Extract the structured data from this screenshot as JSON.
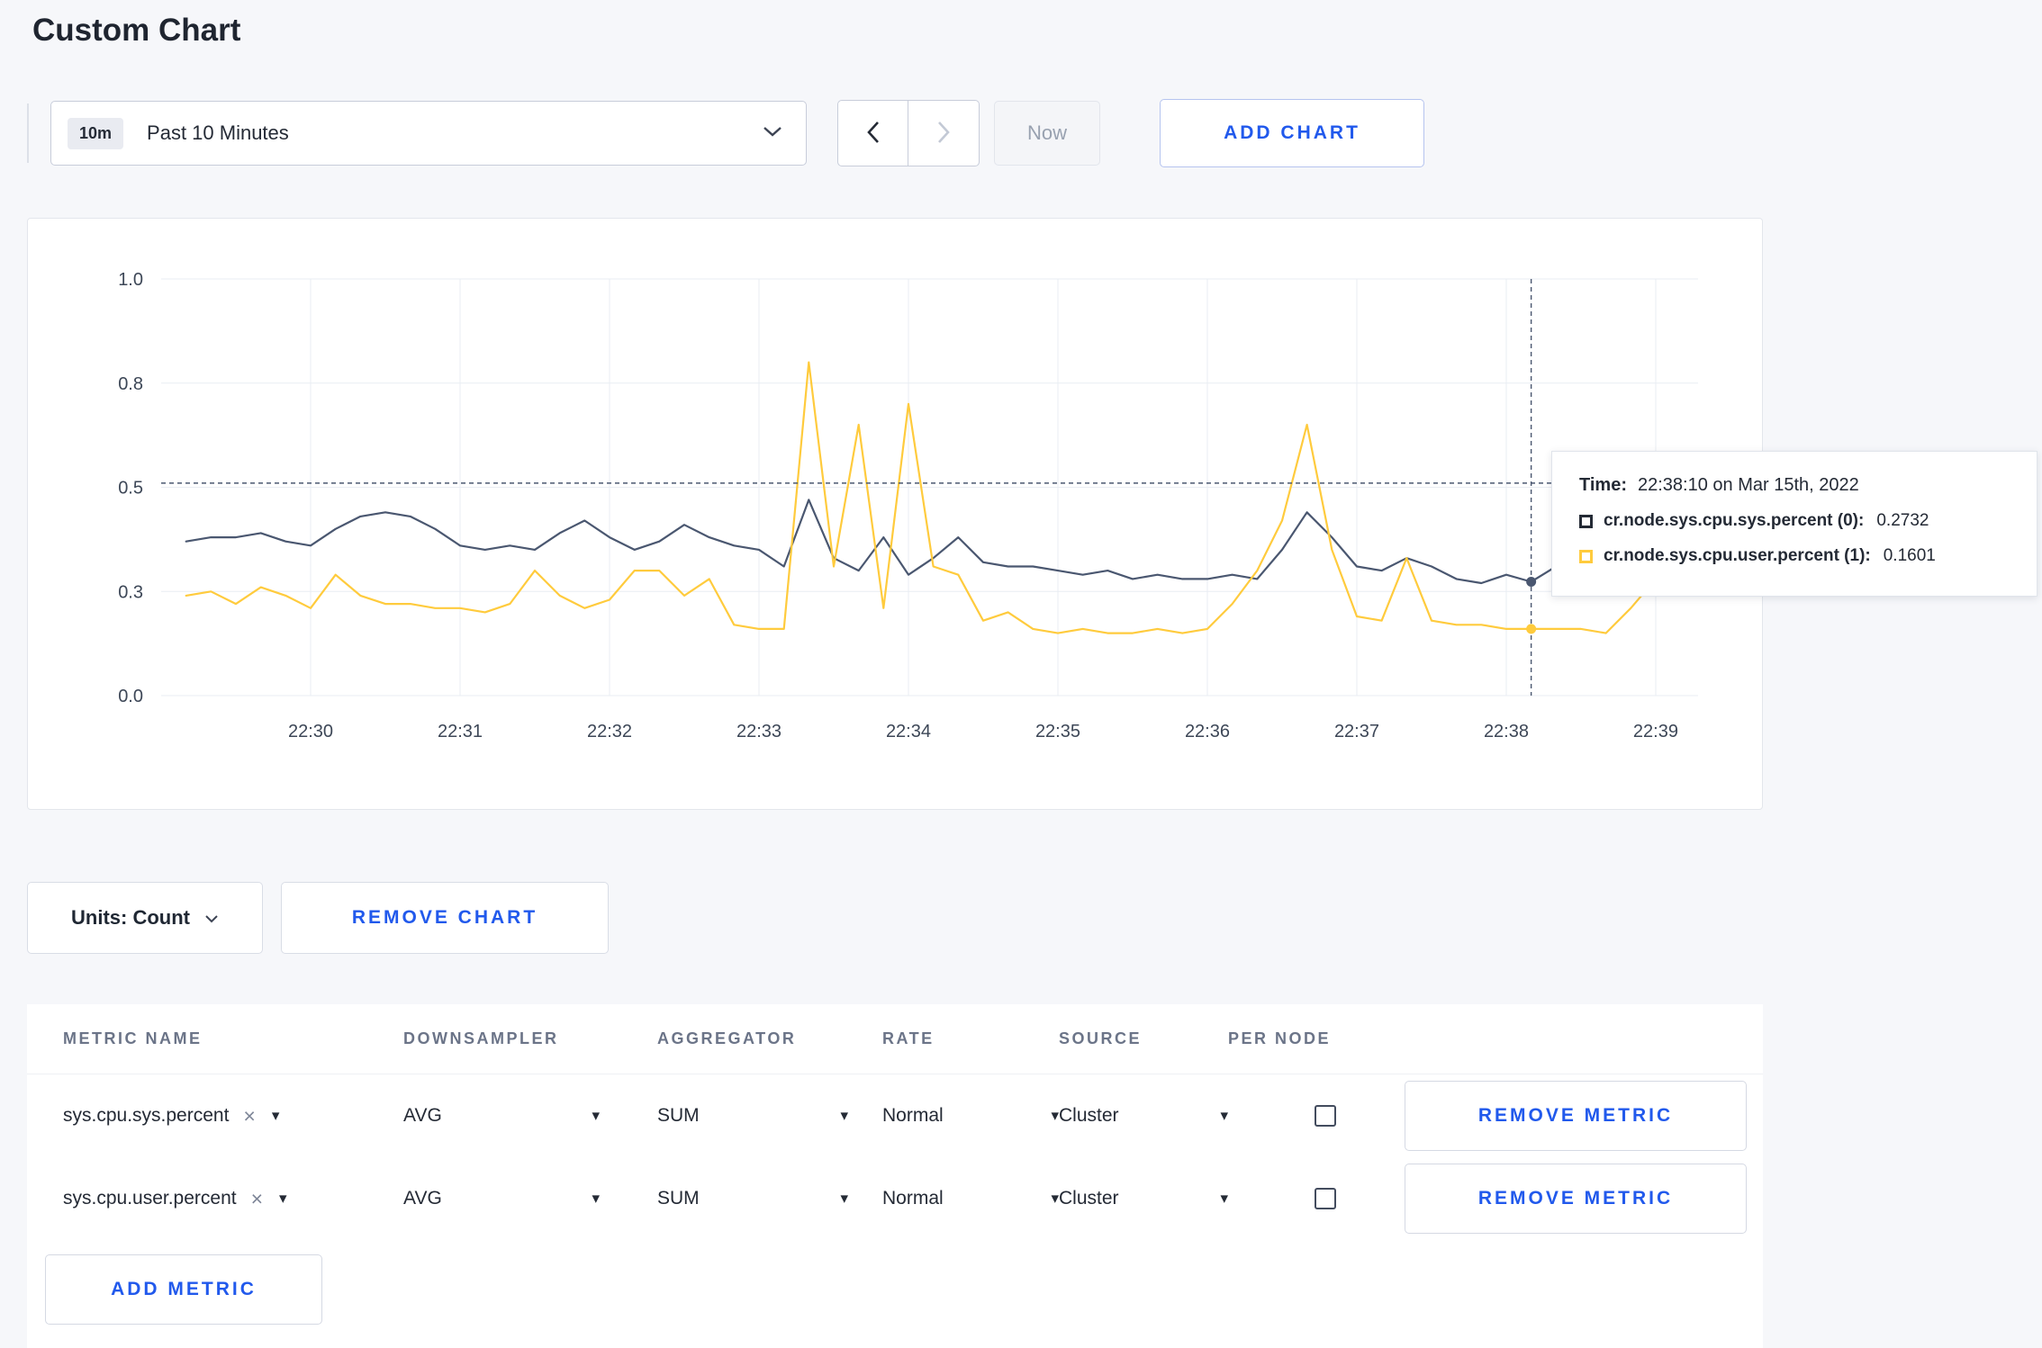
{
  "page": {
    "title": "Custom Chart"
  },
  "colors": {
    "accent_blue": "#2159ec",
    "series_sys": "#4a5770",
    "series_user": "#ffcb3d"
  },
  "icons": {
    "close": "×",
    "caret_down": "▾"
  },
  "toolbar": {
    "range_badge": "10m",
    "range_label": "Past 10 Minutes",
    "now_label": "Now",
    "add_chart_label": "ADD CHART"
  },
  "chart_data": {
    "type": "line",
    "title": "",
    "xlabel": "",
    "ylabel": "",
    "ylim": [
      0,
      1
    ],
    "x_domain_seconds": [
      0,
      617
    ],
    "x_domain_start": "22:29:00",
    "t_first": 10,
    "interval_seconds": 10,
    "grid": true,
    "y_ticks": [
      {
        "v": 0,
        "label": "0.0"
      },
      {
        "v": 0.25,
        "label": "0.3"
      },
      {
        "v": 0.5,
        "label": "0.5"
      },
      {
        "v": 0.75,
        "label": "0.8"
      },
      {
        "v": 1,
        "label": "1.0"
      }
    ],
    "x_ticks": [
      {
        "t": 60,
        "label": "22:30"
      },
      {
        "t": 120,
        "label": "22:31"
      },
      {
        "t": 180,
        "label": "22:32"
      },
      {
        "t": 240,
        "label": "22:33"
      },
      {
        "t": 300,
        "label": "22:34"
      },
      {
        "t": 360,
        "label": "22:35"
      },
      {
        "t": 420,
        "label": "22:36"
      },
      {
        "t": 480,
        "label": "22:37"
      },
      {
        "t": 540,
        "label": "22:38"
      },
      {
        "t": 600,
        "label": "22:39"
      }
    ],
    "series": [
      {
        "name": "cr.node.sys.cpu.sys.percent",
        "color": "#4a5770",
        "values": [
          0.37,
          0.38,
          0.38,
          0.39,
          0.37,
          0.36,
          0.4,
          0.43,
          0.44,
          0.43,
          0.4,
          0.36,
          0.35,
          0.36,
          0.35,
          0.39,
          0.42,
          0.38,
          0.35,
          0.37,
          0.41,
          0.38,
          0.36,
          0.35,
          0.31,
          0.47,
          0.33,
          0.3,
          0.38,
          0.29,
          0.33,
          0.38,
          0.32,
          0.31,
          0.31,
          0.3,
          0.29,
          0.3,
          0.28,
          0.29,
          0.28,
          0.28,
          0.29,
          0.28,
          0.35,
          0.44,
          0.38,
          0.31,
          0.3,
          0.33,
          0.31,
          0.28,
          0.27,
          0.29,
          0.2732,
          0.31,
          0.3,
          0.32,
          0.3,
          0.3,
          0.31
        ]
      },
      {
        "name": "cr.node.sys.cpu.user.percent",
        "color": "#ffcb3d",
        "values": [
          0.24,
          0.25,
          0.22,
          0.26,
          0.24,
          0.21,
          0.29,
          0.24,
          0.22,
          0.22,
          0.21,
          0.21,
          0.2,
          0.22,
          0.3,
          0.24,
          0.21,
          0.23,
          0.3,
          0.3,
          0.24,
          0.28,
          0.17,
          0.16,
          0.16,
          0.8,
          0.31,
          0.65,
          0.21,
          0.7,
          0.31,
          0.29,
          0.18,
          0.2,
          0.16,
          0.15,
          0.16,
          0.15,
          0.15,
          0.16,
          0.15,
          0.16,
          0.22,
          0.3,
          0.42,
          0.65,
          0.35,
          0.19,
          0.18,
          0.33,
          0.18,
          0.17,
          0.17,
          0.16,
          0.1601,
          0.16,
          0.16,
          0.15,
          0.21,
          0.28,
          0.25
        ]
      }
    ],
    "crosshair": {
      "t": 550,
      "hline_value": 0.51,
      "points": [
        {
          "series": 0,
          "v": 0.2732
        },
        {
          "series": 1,
          "v": 0.1601
        }
      ]
    },
    "legend_position": "tooltip"
  },
  "tooltip": {
    "time_label": "Time:",
    "time_value": "22:38:10 on Mar 15th, 2022",
    "entries": [
      {
        "swatch": "#242a35",
        "label": "cr.node.sys.cpu.sys.percent (0):",
        "value": "0.2732"
      },
      {
        "swatch": "#ffcb3d",
        "label": "cr.node.sys.cpu.user.percent (1):",
        "value": "0.1601"
      }
    ]
  },
  "controls": {
    "units_label": "Units: Count",
    "remove_chart_label": "REMOVE CHART"
  },
  "metrics_table": {
    "headers": [
      "METRIC NAME",
      "DOWNSAMPLER",
      "AGGREGATOR",
      "RATE",
      "SOURCE",
      "PER NODE"
    ],
    "rows": [
      {
        "metric": "sys.cpu.sys.percent",
        "downsampler": "AVG",
        "aggregator": "SUM",
        "rate": "Normal",
        "source": "Cluster",
        "per_node_checked": false,
        "remove_label": "REMOVE METRIC"
      },
      {
        "metric": "sys.cpu.user.percent",
        "downsampler": "AVG",
        "aggregator": "SUM",
        "rate": "Normal",
        "source": "Cluster",
        "per_node_checked": false,
        "remove_label": "REMOVE METRIC"
      }
    ],
    "add_metric_label": "ADD METRIC"
  }
}
